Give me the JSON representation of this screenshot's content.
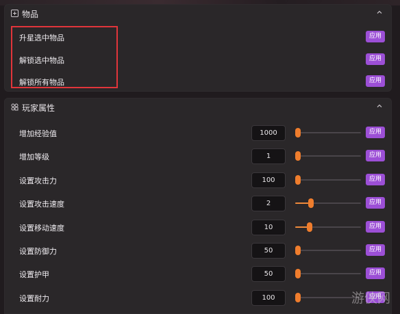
{
  "items_panel": {
    "title": "物品",
    "icon": "box-plus-icon",
    "rows": [
      {
        "label": "升星选中物品",
        "button": "应用"
      },
      {
        "label": "解锁选中物品",
        "button": "应用"
      },
      {
        "label": "解锁所有物品",
        "button": "应用"
      }
    ]
  },
  "attrs_panel": {
    "title": "玩家属性",
    "icon": "attributes-icon",
    "rows": [
      {
        "label": "增加经验值",
        "value": "1000",
        "slider_fraction": 0.0,
        "button": "应用"
      },
      {
        "label": "增加等级",
        "value": "1",
        "slider_fraction": 0.0,
        "button": "应用"
      },
      {
        "label": "设置攻击力",
        "value": "100",
        "slider_fraction": 0.0,
        "button": "应用"
      },
      {
        "label": "设置攻击速度",
        "value": "2",
        "slider_fraction": 0.2,
        "button": "应用"
      },
      {
        "label": "设置移动速度",
        "value": "10",
        "slider_fraction": 0.18,
        "button": "应用"
      },
      {
        "label": "设置防御力",
        "value": "50",
        "slider_fraction": 0.0,
        "button": "应用"
      },
      {
        "label": "设置护甲",
        "value": "50",
        "slider_fraction": 0.0,
        "button": "应用"
      },
      {
        "label": "设置耐力",
        "value": "100",
        "slider_fraction": 0.0,
        "button": "应用"
      }
    ]
  },
  "watermark": {
    "text": "游侠网"
  },
  "colors": {
    "accent_button": "#9c4fd6",
    "slider": "#ef7d2d",
    "highlight": "#e2353b"
  }
}
